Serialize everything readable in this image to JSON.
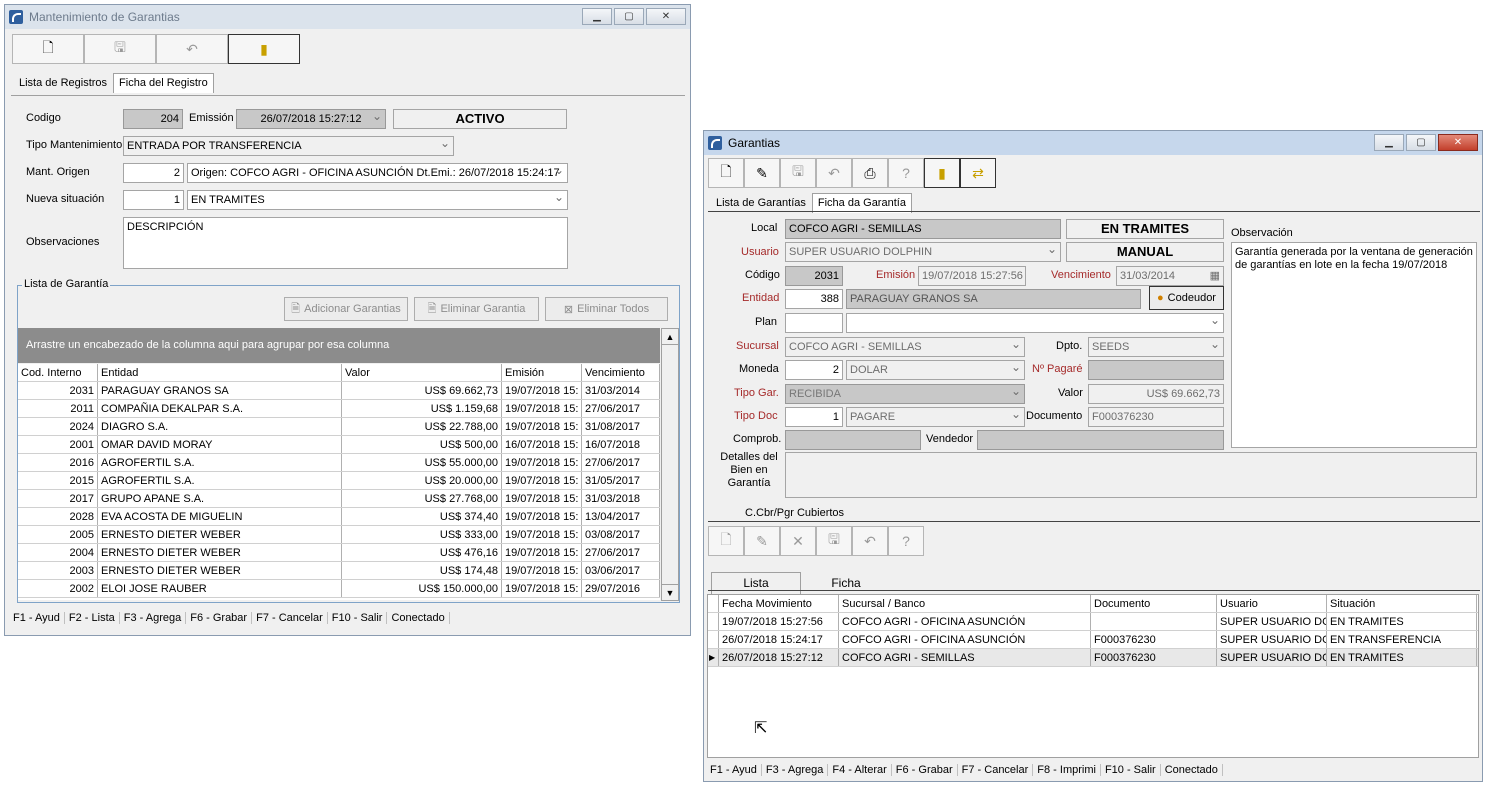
{
  "win1": {
    "title": "Mantenimiento de Garantias",
    "tabs": [
      "Lista de Registros",
      "Ficha del Registro"
    ],
    "codigo_label": "Codigo",
    "codigo": "204",
    "emision_label": "Emissión",
    "emision": "26/07/2018 15:27:12",
    "estado": "ACTIVO",
    "tipo_label": "Tipo Mantenimiento",
    "tipo": "ENTRADA POR TRANSFERENCIA",
    "origen_label": "Mant. Origen",
    "origen_num": "2",
    "origen_text": "Origen: COFCO AGRI - OFICINA ASUNCIÓN Dt.Emi.: 26/07/2018 15:24:17",
    "nueva_label": "Nueva situación",
    "nueva_num": "1",
    "nueva_text": "EN TRAMITES",
    "obs_label": "Observaciones",
    "obs": "DESCRIPCIÓN",
    "lista_legend": "Lista de Garantía",
    "btn_add": "Adicionar Garantias",
    "btn_del": "Eliminar Garantia",
    "btn_delall": "Eliminar Todos",
    "group_hint": "Arrastre un encabezado de la columna aqui para agrupar por esa columna",
    "columns": [
      "Cod. Interno",
      "Entidad",
      "Valor",
      "Emisión",
      "Vencimiento"
    ],
    "rows": [
      [
        "2031",
        "PARAGUAY GRANOS SA",
        "US$ 69.662,73",
        "19/07/2018 15:",
        "31/03/2014"
      ],
      [
        "2011",
        "COMPAÑIA DEKALPAR S.A.",
        "US$ 1.159,68",
        "19/07/2018 15:",
        "27/06/2017"
      ],
      [
        "2024",
        "DIAGRO S.A.",
        "US$ 22.788,00",
        "19/07/2018 15:",
        "31/08/2017"
      ],
      [
        "2001",
        "OMAR DAVID MORAY",
        "US$ 500,00",
        "16/07/2018 15:",
        "16/07/2018"
      ],
      [
        "2016",
        "AGROFERTIL S.A.",
        "US$ 55.000,00",
        "19/07/2018 15:",
        "27/06/2017"
      ],
      [
        "2015",
        "AGROFERTIL S.A.",
        "US$ 20.000,00",
        "19/07/2018 15:",
        "31/05/2017"
      ],
      [
        "2017",
        "GRUPO APANE S.A.",
        "US$ 27.768,00",
        "19/07/2018 15:",
        "31/03/2018"
      ],
      [
        "2028",
        "EVA ACOSTA DE MIGUELIN",
        "US$ 374,40",
        "19/07/2018 15:",
        "13/04/2017"
      ],
      [
        "2005",
        "ERNESTO DIETER WEBER",
        "US$ 333,00",
        "19/07/2018 15:",
        "03/08/2017"
      ],
      [
        "2004",
        "ERNESTO DIETER WEBER",
        "US$ 476,16",
        "19/07/2018 15:",
        "27/06/2017"
      ],
      [
        "2003",
        "ERNESTO DIETER WEBER",
        "US$ 174,48",
        "19/07/2018 15:",
        "03/06/2017"
      ],
      [
        "2002",
        "ELOI JOSE RAUBER",
        "US$ 150.000,00",
        "19/07/2018 15:",
        "29/07/2016"
      ]
    ],
    "status": [
      "F1 - Ayud",
      "F2 - Lista",
      "F3 - Agrega",
      "F6 - Grabar",
      "F7 - Cancelar",
      "F10 - Salir",
      "Conectado"
    ]
  },
  "win2": {
    "title": "Garantias",
    "tabs": [
      "Lista de Garantías",
      "Ficha da Garantía"
    ],
    "local_label": "Local",
    "local": "COFCO AGRI - SEMILLAS",
    "estado": "EN TRAMITES",
    "obs_label": "Observación",
    "usuario_label": "Usuario",
    "usuario": "SUPER USUARIO DOLPHIN",
    "tipo": "MANUAL",
    "obs": "Garantía generada por la ventana de generación de garantías en lote en la fecha 19/07/2018",
    "codigo_label": "Código",
    "codigo": "2031",
    "emision_label": "Emisión",
    "emision": "19/07/2018 15:27:56",
    "venc_label": "Vencimiento",
    "venc": "31/03/2014",
    "entidad_label": "Entidad",
    "entidad_num": "388",
    "entidad": "PARAGUAY GRANOS SA",
    "codeudor": "Codeudor",
    "plan_label": "Plan",
    "sucursal_label": "Sucursal",
    "sucursal": "COFCO AGRI - SEMILLAS",
    "dpto_label": "Dpto.",
    "dpto": "SEEDS",
    "moneda_label": "Moneda",
    "moneda_num": "2",
    "moneda": "DOLAR",
    "pagare_label": "Nº Pagaré",
    "tipogar_label": "Tipo Gar.",
    "tipogar": "RECIBIDA",
    "valor_label": "Valor",
    "valor": "US$ 69.662,73",
    "tipodoc_label": "Tipo Doc",
    "tipodoc_num": "1",
    "tipodoc": "PAGARE",
    "documento_label": "Documento",
    "documento": "F000376230",
    "comprob_label": "Comprob.",
    "vendedor_label": "Vendedor",
    "detalles_label": "Detalles del Bien en Garantía",
    "ccbr_label": "C.Cbr/Pgr Cubiertos",
    "subtabs": [
      "Lista",
      "Ficha"
    ],
    "columns": [
      "Fecha Movimiento",
      "Sucursal / Banco",
      "Documento",
      "Usuario",
      "Situación"
    ],
    "rows": [
      [
        "19/07/2018 15:27:56",
        "COFCO AGRI - OFICINA ASUNCIÓN",
        "",
        "SUPER USUARIO DC",
        "EN TRAMITES"
      ],
      [
        "26/07/2018 15:24:17",
        "COFCO AGRI - OFICINA ASUNCIÓN",
        "F000376230",
        "SUPER USUARIO DC",
        "EN TRANSFERENCIA"
      ],
      [
        "26/07/2018 15:27:12",
        "COFCO AGRI - SEMILLAS",
        "F000376230",
        "SUPER USUARIO DC",
        "EN TRAMITES"
      ]
    ],
    "status": [
      "F1 - Ayud",
      "F3 - Agrega",
      "F4 - Alterar",
      "F6 - Grabar",
      "F7 - Cancelar",
      "F8 - Imprimi",
      "F10 - Salir",
      "Conectado"
    ]
  }
}
